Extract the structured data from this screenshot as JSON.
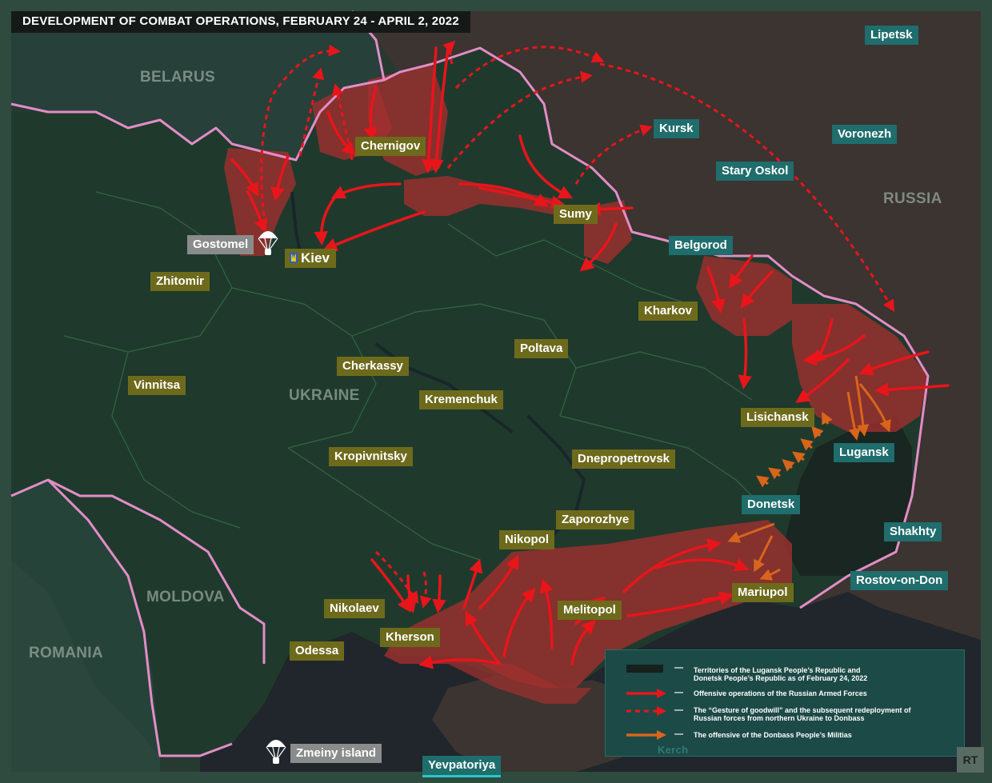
{
  "title": "DEVELOPMENT OF COMBAT OPERATIONS, FEBRUARY 24 - APRIL 2, 2022",
  "colors": {
    "ukraine_land": "#1f3a2c",
    "russia_land": "#3a342e",
    "occupied": "#a3302f",
    "border": "#e28dc7",
    "offensive": "#e8151b",
    "militia": "#d8651a",
    "ua_label": "#6e6a1c",
    "ru_label": "#1f6d6c",
    "sea": "#1e2428"
  },
  "countries": {
    "belarus": "BELARUS",
    "russia": "RUSSIA",
    "ukraine": "UKRAINE",
    "moldova": "MOLDOVA",
    "romania": "ROMANIA"
  },
  "cities_ukraine": {
    "chernigov": "Chernigov",
    "sumy": "Sumy",
    "kiev": "Kiev",
    "zhitomir": "Zhitomir",
    "kharkov": "Kharkov",
    "poltava": "Poltava",
    "cherkassy": "Cherkassy",
    "vinnitsa": "Vinnitsa",
    "kremenchuk": "Kremenchuk",
    "lisichansk": "Lisichansk",
    "kropivnitsky": "Kropivnitsky",
    "dnepropetrovsk": "Dnepropetrovsk",
    "zaporozhye": "Zaporozhye",
    "nikopol": "Nikopol",
    "nikolaev": "Nikolaev",
    "melitopol": "Melitopol",
    "mariupol": "Mariupol",
    "kherson": "Kherson",
    "odessa": "Odessa"
  },
  "cities_russia": {
    "lipetsk": "Lipetsk",
    "kursk": "Kursk",
    "voronezh": "Voronezh",
    "stary_oskol": "Stary Oskol",
    "belgorod": "Belgorod",
    "lugansk": "Lugansk",
    "donetsk": "Donetsk",
    "shakhty": "Shakhty",
    "rostov": "Rostov-on-Don",
    "yevpatoriya": "Yevpatoriya"
  },
  "airborne": {
    "gostomel": "Gostomel",
    "zmeiny": "Zmeiny island"
  },
  "sea_labels": {
    "kerch": "Kerch"
  },
  "legend": {
    "items": [
      {
        "dash": "—",
        "text": "Territories of the Lugansk People’s Republic and Donetsk People’s Republic as of February 24, 2022",
        "symbol": "territory"
      },
      {
        "dash": "—",
        "text": "Offensive operations of the Russian Armed Forces",
        "symbol": "solid-red-arrow"
      },
      {
        "dash": "—",
        "text": "The “Gesture of goodwill” and the subsequent redeployment of Russian forces from northern Ukraine to Donbass",
        "symbol": "dashed-red-arrow"
      },
      {
        "dash": "—",
        "text": "The offensive of the Donbass People’s Militias",
        "symbol": "orange-arrow"
      }
    ]
  },
  "logo": "RT"
}
